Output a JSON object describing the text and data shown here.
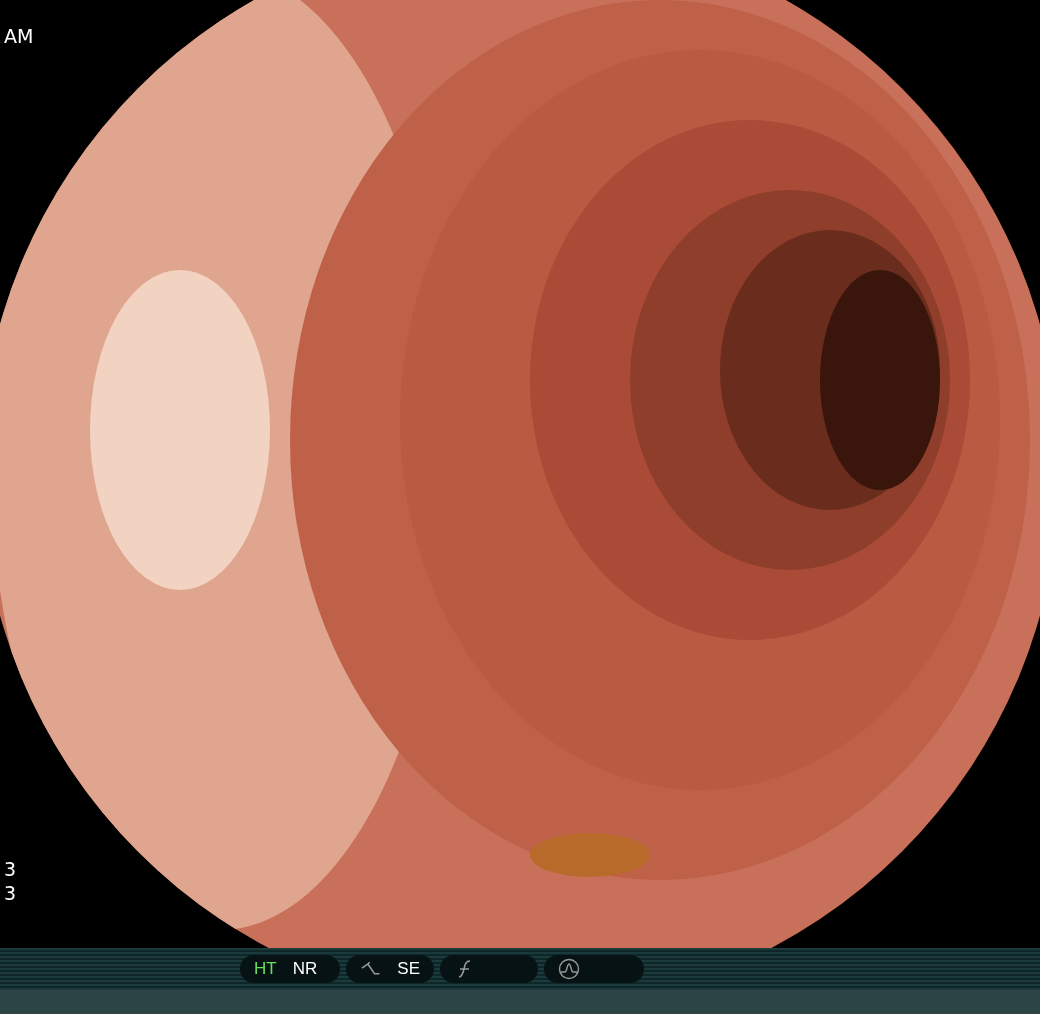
{
  "overlay": {
    "top_text": "AM",
    "bottom_lines": [
      "3",
      "3"
    ]
  },
  "status_bar": {
    "groups": [
      {
        "kind": "plain",
        "items": [
          {
            "label": "HT",
            "on": true
          },
          {
            "label": "NR",
            "on": false
          }
        ]
      },
      {
        "kind": "curve",
        "items": [
          {
            "label": "SE",
            "on": false
          }
        ]
      },
      {
        "kind": "function"
      },
      {
        "kind": "wave"
      }
    ]
  }
}
